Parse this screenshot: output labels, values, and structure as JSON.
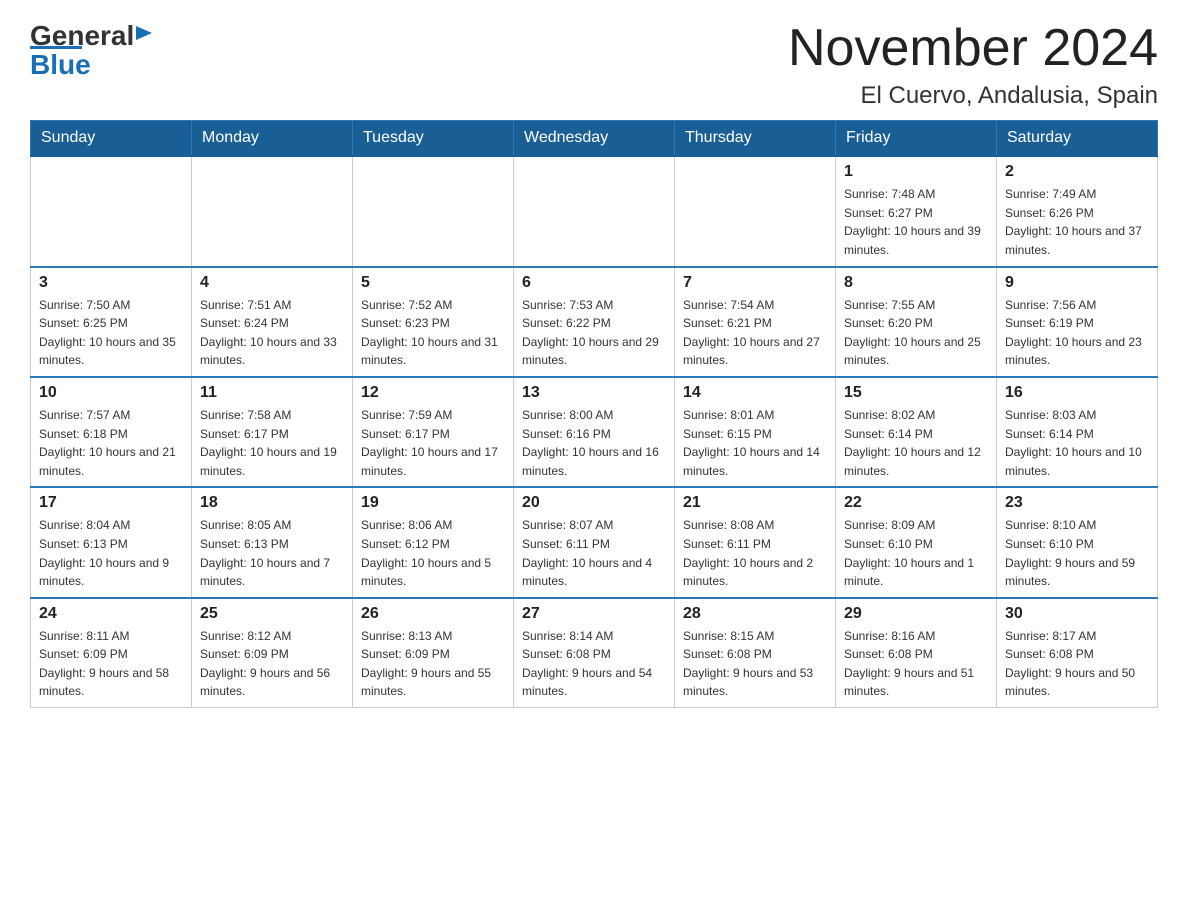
{
  "header": {
    "logo_general": "General",
    "logo_blue": "Blue",
    "main_title": "November 2024",
    "subtitle": "El Cuervo, Andalusia, Spain"
  },
  "days_of_week": [
    "Sunday",
    "Monday",
    "Tuesday",
    "Wednesday",
    "Thursday",
    "Friday",
    "Saturday"
  ],
  "weeks": [
    [
      {
        "day": "",
        "info": ""
      },
      {
        "day": "",
        "info": ""
      },
      {
        "day": "",
        "info": ""
      },
      {
        "day": "",
        "info": ""
      },
      {
        "day": "",
        "info": ""
      },
      {
        "day": "1",
        "info": "Sunrise: 7:48 AM\nSunset: 6:27 PM\nDaylight: 10 hours and 39 minutes."
      },
      {
        "day": "2",
        "info": "Sunrise: 7:49 AM\nSunset: 6:26 PM\nDaylight: 10 hours and 37 minutes."
      }
    ],
    [
      {
        "day": "3",
        "info": "Sunrise: 7:50 AM\nSunset: 6:25 PM\nDaylight: 10 hours and 35 minutes."
      },
      {
        "day": "4",
        "info": "Sunrise: 7:51 AM\nSunset: 6:24 PM\nDaylight: 10 hours and 33 minutes."
      },
      {
        "day": "5",
        "info": "Sunrise: 7:52 AM\nSunset: 6:23 PM\nDaylight: 10 hours and 31 minutes."
      },
      {
        "day": "6",
        "info": "Sunrise: 7:53 AM\nSunset: 6:22 PM\nDaylight: 10 hours and 29 minutes."
      },
      {
        "day": "7",
        "info": "Sunrise: 7:54 AM\nSunset: 6:21 PM\nDaylight: 10 hours and 27 minutes."
      },
      {
        "day": "8",
        "info": "Sunrise: 7:55 AM\nSunset: 6:20 PM\nDaylight: 10 hours and 25 minutes."
      },
      {
        "day": "9",
        "info": "Sunrise: 7:56 AM\nSunset: 6:19 PM\nDaylight: 10 hours and 23 minutes."
      }
    ],
    [
      {
        "day": "10",
        "info": "Sunrise: 7:57 AM\nSunset: 6:18 PM\nDaylight: 10 hours and 21 minutes."
      },
      {
        "day": "11",
        "info": "Sunrise: 7:58 AM\nSunset: 6:17 PM\nDaylight: 10 hours and 19 minutes."
      },
      {
        "day": "12",
        "info": "Sunrise: 7:59 AM\nSunset: 6:17 PM\nDaylight: 10 hours and 17 minutes."
      },
      {
        "day": "13",
        "info": "Sunrise: 8:00 AM\nSunset: 6:16 PM\nDaylight: 10 hours and 16 minutes."
      },
      {
        "day": "14",
        "info": "Sunrise: 8:01 AM\nSunset: 6:15 PM\nDaylight: 10 hours and 14 minutes."
      },
      {
        "day": "15",
        "info": "Sunrise: 8:02 AM\nSunset: 6:14 PM\nDaylight: 10 hours and 12 minutes."
      },
      {
        "day": "16",
        "info": "Sunrise: 8:03 AM\nSunset: 6:14 PM\nDaylight: 10 hours and 10 minutes."
      }
    ],
    [
      {
        "day": "17",
        "info": "Sunrise: 8:04 AM\nSunset: 6:13 PM\nDaylight: 10 hours and 9 minutes."
      },
      {
        "day": "18",
        "info": "Sunrise: 8:05 AM\nSunset: 6:13 PM\nDaylight: 10 hours and 7 minutes."
      },
      {
        "day": "19",
        "info": "Sunrise: 8:06 AM\nSunset: 6:12 PM\nDaylight: 10 hours and 5 minutes."
      },
      {
        "day": "20",
        "info": "Sunrise: 8:07 AM\nSunset: 6:11 PM\nDaylight: 10 hours and 4 minutes."
      },
      {
        "day": "21",
        "info": "Sunrise: 8:08 AM\nSunset: 6:11 PM\nDaylight: 10 hours and 2 minutes."
      },
      {
        "day": "22",
        "info": "Sunrise: 8:09 AM\nSunset: 6:10 PM\nDaylight: 10 hours and 1 minute."
      },
      {
        "day": "23",
        "info": "Sunrise: 8:10 AM\nSunset: 6:10 PM\nDaylight: 9 hours and 59 minutes."
      }
    ],
    [
      {
        "day": "24",
        "info": "Sunrise: 8:11 AM\nSunset: 6:09 PM\nDaylight: 9 hours and 58 minutes."
      },
      {
        "day": "25",
        "info": "Sunrise: 8:12 AM\nSunset: 6:09 PM\nDaylight: 9 hours and 56 minutes."
      },
      {
        "day": "26",
        "info": "Sunrise: 8:13 AM\nSunset: 6:09 PM\nDaylight: 9 hours and 55 minutes."
      },
      {
        "day": "27",
        "info": "Sunrise: 8:14 AM\nSunset: 6:08 PM\nDaylight: 9 hours and 54 minutes."
      },
      {
        "day": "28",
        "info": "Sunrise: 8:15 AM\nSunset: 6:08 PM\nDaylight: 9 hours and 53 minutes."
      },
      {
        "day": "29",
        "info": "Sunrise: 8:16 AM\nSunset: 6:08 PM\nDaylight: 9 hours and 51 minutes."
      },
      {
        "day": "30",
        "info": "Sunrise: 8:17 AM\nSunset: 6:08 PM\nDaylight: 9 hours and 50 minutes."
      }
    ]
  ]
}
